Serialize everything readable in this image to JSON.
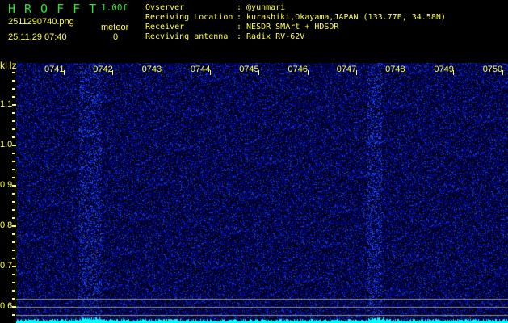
{
  "header": {
    "app_title": "HROFFT",
    "version": "1.00f",
    "filename": "2511290740.png",
    "datetime": "25.11.29 07:40",
    "meteor_label": "meteor",
    "meteor_count": "0",
    "info": [
      {
        "label": "Ovserver",
        "value": ": @yuhmari"
      },
      {
        "label": "Receiving Location",
        "value": ": kurashiki,Okayama,JAPAN (133.77E, 34.58N)"
      },
      {
        "label": "Receiver",
        "value": ": NESDR SMArt + HDSDR"
      },
      {
        "label": "Recviving antenna",
        "value": ": Radix RV-62V"
      }
    ]
  },
  "axis": {
    "unit": "kHz",
    "freq_labels": [
      "1.1",
      "1.0",
      "0.9",
      "0.8",
      "0.7",
      "0.6"
    ],
    "minute_labels": [
      "0741",
      "0742",
      "0743",
      "0744",
      "0745",
      "0746",
      "0747",
      "0748",
      "0749",
      "0750"
    ]
  },
  "colors": {
    "text": "#ffff40",
    "title": "#30e030",
    "noise": "#2020ff",
    "level": "#00ffff"
  }
}
